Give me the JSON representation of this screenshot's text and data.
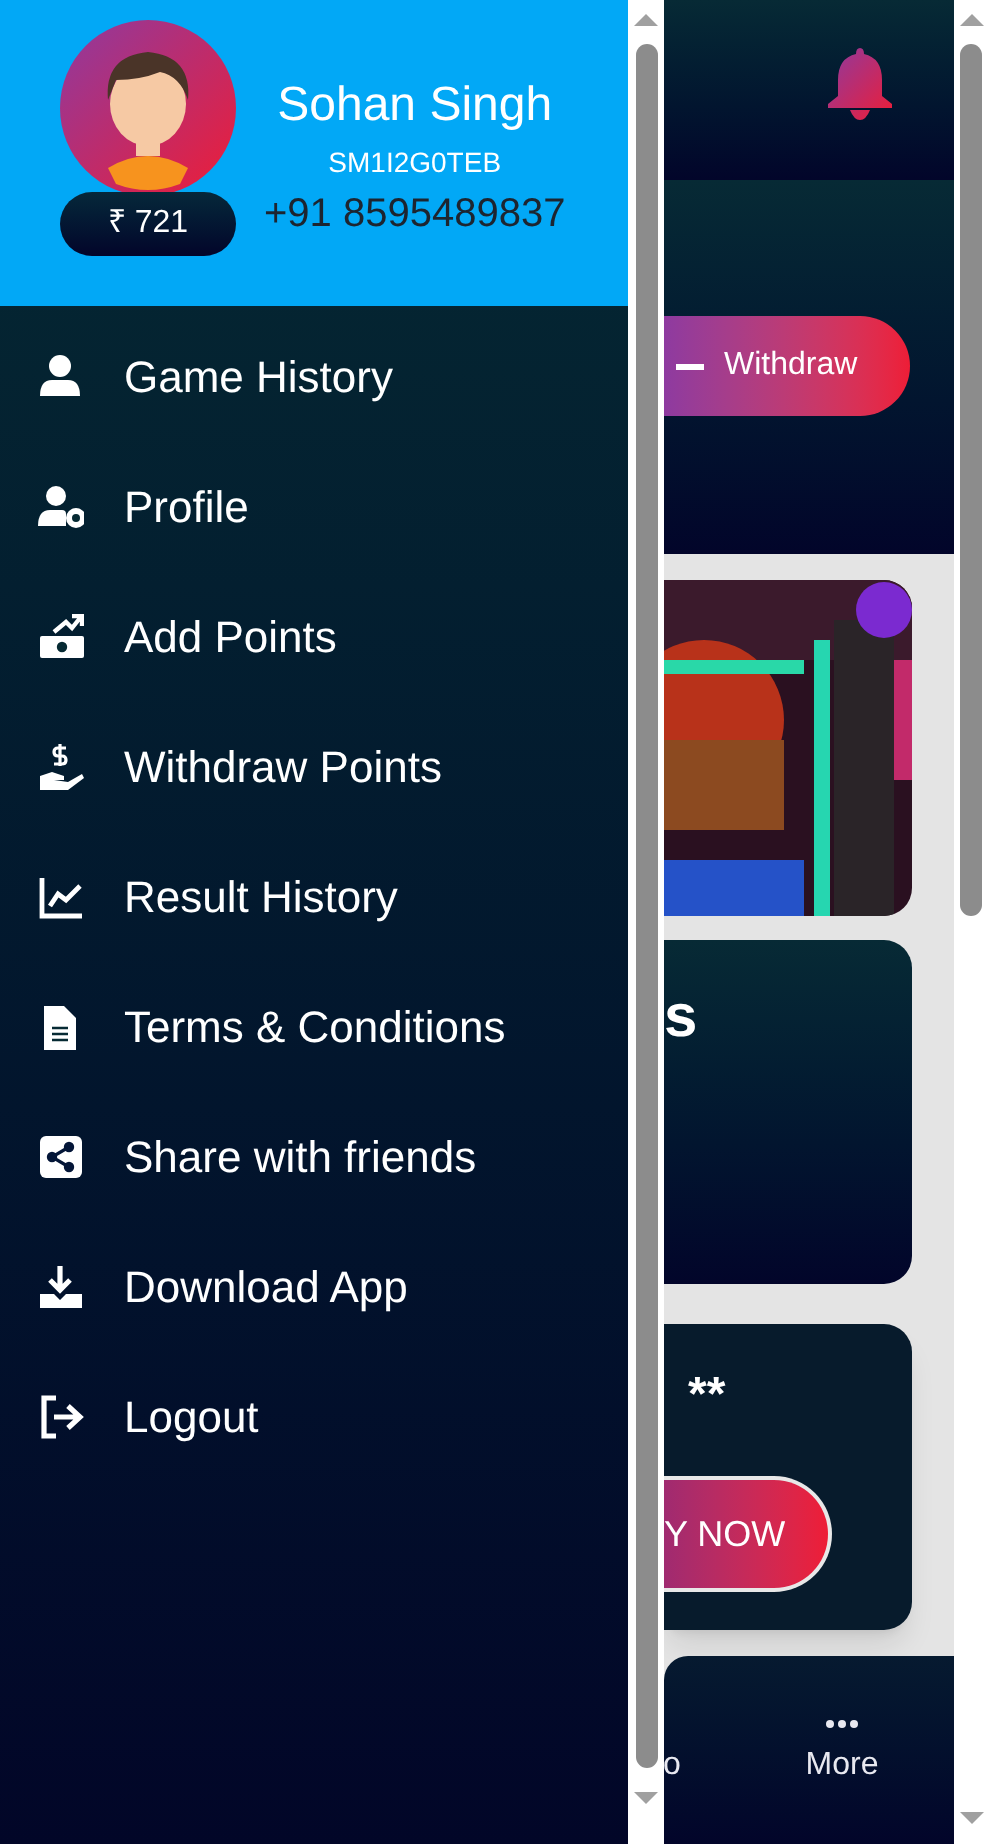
{
  "profile": {
    "name": "Sohan Singh",
    "user_id": "SM1I2G0TEB",
    "phone": "+91 8595489837",
    "balance": "₹ 721"
  },
  "menu": [
    {
      "label": "Game History",
      "kind": "user"
    },
    {
      "label": "Profile",
      "kind": "user-gear"
    },
    {
      "label": "Add Points",
      "kind": "money-up"
    },
    {
      "label": "Withdraw Points",
      "kind": "hand-dollar"
    },
    {
      "label": "Result History",
      "kind": "chart"
    },
    {
      "label": "Terms & Conditions",
      "kind": "file"
    },
    {
      "label": "Share with friends",
      "kind": "share"
    },
    {
      "label": "Download App",
      "kind": "download"
    },
    {
      "label": "Logout",
      "kind": "logout"
    }
  ],
  "background_page": {
    "withdraw_button": "Withdraw",
    "card_title": "s",
    "card_text": "**",
    "play_button": "Y NOW",
    "nav_items": [
      {
        "label": "o",
        "kind": "text"
      },
      {
        "label": "More",
        "kind": "dots"
      }
    ]
  }
}
